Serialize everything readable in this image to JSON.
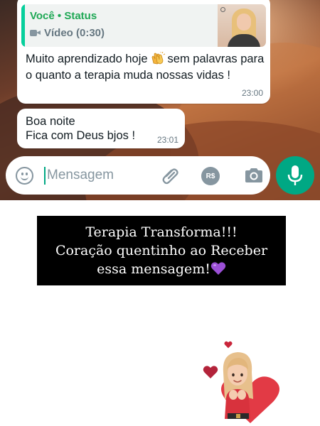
{
  "chat": {
    "reply": {
      "author": "Você • Status",
      "media_type": "Vídeo (0:30)",
      "media_icon": "video-camera-icon"
    },
    "message1": {
      "before_emoji": "Muito aprendizado hoje",
      "emoji": "clapping-hands-emoji",
      "after_emoji": "sem palavras para o quanto a terapia muda nossas vidas !",
      "time": "23:00"
    },
    "message2": {
      "line1": "Boa noite",
      "line2": "Fica com Deus bjos !",
      "time": "23:01"
    },
    "composer": {
      "placeholder": "Mensagem",
      "payment_label": "R$",
      "icons": [
        "emoji-icon",
        "attach-icon",
        "payment-icon",
        "camera-icon",
        "microphone-icon"
      ]
    }
  },
  "caption": {
    "line1": "Terapia Transforma!!!",
    "line2": "Coração quentinho ao Receber",
    "line3": "essa mensagem!",
    "emoji": "purple-heart-emoji"
  },
  "colors": {
    "accent": "#00a884",
    "author": "#1fa855",
    "caption_bg": "#000000",
    "purple_heart": "#9b4fd6"
  }
}
